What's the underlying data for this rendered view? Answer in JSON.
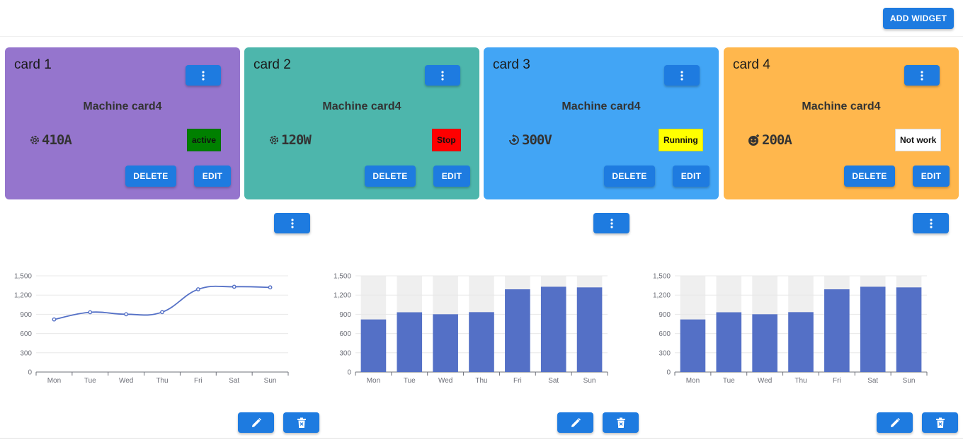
{
  "toolbar": {
    "add_widget_label": "ADD WIDGET"
  },
  "cards": [
    {
      "title": "card 1",
      "heading": "Machine card4",
      "reading": "410A",
      "icon": "gear-icon",
      "status": "active",
      "status_bg": "#008000",
      "status_fg": "#111111",
      "bg": "#9575cd",
      "delete_label": "DELETE",
      "edit_label": "EDIT"
    },
    {
      "title": "card 2",
      "heading": "Machine card4",
      "reading": "120W",
      "icon": "gear-icon",
      "status": "Stop",
      "status_bg": "#ff0000",
      "status_fg": "#111111",
      "bg": "#4db6ac",
      "delete_label": "DELETE",
      "edit_label": "EDIT"
    },
    {
      "title": "card 3",
      "heading": "Machine card4",
      "reading": "300V",
      "icon": "gauge-icon",
      "status": "Running",
      "status_bg": "#ffff00",
      "status_fg": "#111111",
      "bg": "#42a5f5",
      "delete_label": "DELETE",
      "edit_label": "EDIT"
    },
    {
      "title": "card 4",
      "heading": "Machine card4",
      "reading": "200A",
      "icon": "emoji-icon",
      "status": "Not work",
      "status_bg": "#ffffff",
      "status_fg": "#111111",
      "bg": "#ffb74d",
      "delete_label": "DELETE",
      "edit_label": "EDIT"
    }
  ],
  "colors": {
    "accent": "#1e7be0",
    "series": "#5470c6",
    "bar_background": "#efefef"
  },
  "chart_data": [
    {
      "type": "line",
      "categories": [
        "Mon",
        "Tue",
        "Wed",
        "Thu",
        "Fri",
        "Sat",
        "Sun"
      ],
      "series": [
        {
          "values": [
            820,
            932,
            901,
            934,
            1290,
            1330,
            1320
          ]
        }
      ],
      "yticks": [
        "0",
        "300",
        "600",
        "900",
        "1,200",
        "1,500"
      ],
      "ylim": [
        0,
        1500
      ],
      "smooth": true,
      "grid": true
    },
    {
      "type": "bar",
      "categories": [
        "Mon",
        "Tue",
        "Wed",
        "Thu",
        "Fri",
        "Sat",
        "Sun"
      ],
      "series": [
        {
          "values": [
            820,
            932,
            901,
            934,
            1290,
            1330,
            1320
          ]
        }
      ],
      "yticks": [
        "0",
        "300",
        "600",
        "900",
        "1,200",
        "1,500"
      ],
      "ylim": [
        0,
        1500
      ],
      "show_background": true,
      "grid": true
    },
    {
      "type": "bar",
      "categories": [
        "Mon",
        "Tue",
        "Wed",
        "Thu",
        "Fri",
        "Sat",
        "Sun"
      ],
      "series": [
        {
          "values": [
            820,
            932,
            901,
            934,
            1290,
            1330,
            1320
          ]
        }
      ],
      "yticks": [
        "0",
        "300",
        "600",
        "900",
        "1,200",
        "1,500"
      ],
      "ylim": [
        0,
        1500
      ],
      "show_background": true,
      "grid": true
    }
  ]
}
